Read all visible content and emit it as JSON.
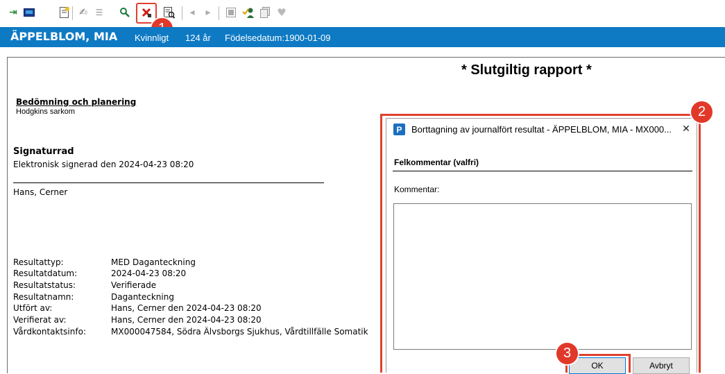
{
  "toolbar": {
    "icons": [
      "exit-icon",
      "card-icon",
      "new-document-icon",
      "sign-icon",
      "list-icon",
      "search-icon",
      "delete-result-icon",
      "print-preview-icon",
      "arrow-left-icon",
      "arrow-right-icon",
      "image-icon",
      "user-check-icon",
      "documents-icon",
      "heart-icon"
    ],
    "highlight_color": "#e0402f"
  },
  "callouts": {
    "one": "1",
    "two": "2",
    "three": "3"
  },
  "patient": {
    "name": "ÄPPELBLOM, MIA",
    "gender": "Kvinnligt",
    "age": "124 år",
    "birthdate": "Födelsedatum:1900-01-09",
    "bar_color": "#0e7ac4"
  },
  "report": {
    "title": "* Slutgiltig rapport *",
    "assessment_heading": "Bedömning och planering",
    "assessment_text": "Hodgkins sarkom",
    "signature_heading": "Signaturrad",
    "signature_text": "Elektronisk signerad den 2024-04-23 08:20",
    "signer": "Hans, Cerner",
    "fields": [
      {
        "label": "Resultattyp:",
        "value": "MED Daganteckning"
      },
      {
        "label": "Resultatdatum:",
        "value": "2024-04-23 08:20"
      },
      {
        "label": "Resultatstatus:",
        "value": "Verifierade"
      },
      {
        "label": "Resultatnamn:",
        "value": "Daganteckning"
      },
      {
        "label": "Utfört av:",
        "value": "Hans, Cerner den 2024-04-23 08:20"
      },
      {
        "label": "Verifierat av:",
        "value": "Hans, Cerner den 2024-04-23 08:20"
      },
      {
        "label": "Vårdkontaktsinfo:",
        "value": "MX000047584, Södra Älvsborgs Sjukhus, Vårdtillfälle Somatik"
      }
    ]
  },
  "dialog": {
    "app_icon_letter": "P",
    "title": "Borttagning av journalfört resultat - ÄPPELBLOM, MIA - MX000...",
    "close_glyph": "✕",
    "section_heading": "Felkommentar (valfri)",
    "comment_label": "Kommentar:",
    "comment_value": "",
    "ok_label": "OK",
    "cancel_label": "Avbryt"
  }
}
